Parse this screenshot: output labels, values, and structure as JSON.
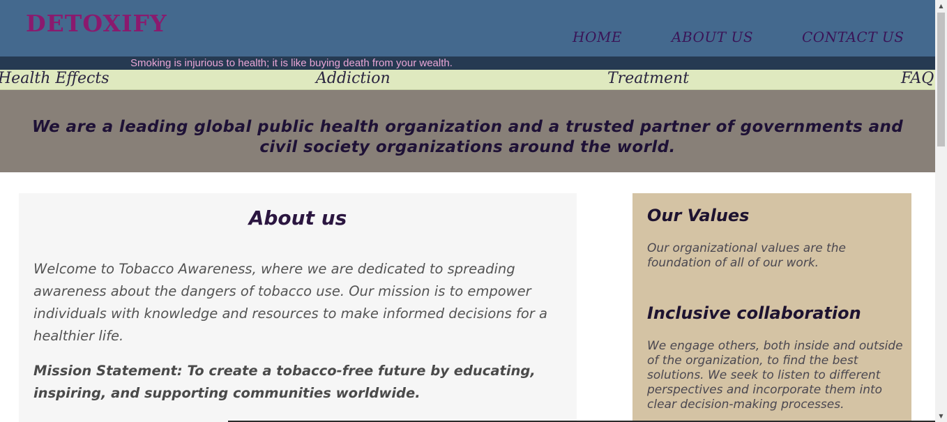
{
  "header": {
    "logo": "DETOXIFY",
    "nav": [
      "HOME",
      "ABOUT US",
      "CONTACT US"
    ]
  },
  "marquee": {
    "text": "Smoking is injurious to health; it is like buying death from your wealth."
  },
  "subnav": {
    "items": [
      "Health Effects",
      "Addiction",
      "Treatment",
      "FAQ"
    ]
  },
  "banner": {
    "text": "We are a leading global public health organization and a trusted partner of governments and civil society organizations around the world."
  },
  "about": {
    "title": "About us",
    "paragraph": "Welcome to Tobacco Awareness, where we are dedicated to spreading awareness about the dangers of tobacco use. Our mission is to empower individuals with knowledge and resources to make informed decisions for a healthier life.",
    "mission": "Mission Statement: To create a tobacco-free future by educating, inspiring, and supporting communities worldwide."
  },
  "values": {
    "heading": "Our Values",
    "intro": "Our organizational values are the foundation of all of our work.",
    "collab_heading": "Inclusive collaboration",
    "collab_text": "We engage others, both inside and outside of the organization, to find the best solutions. We seek to listen to different perspectives and incorporate them into clear decision-making processes."
  },
  "colors": {
    "header_bg": "#44698e",
    "logo": "#8a1a6e",
    "marquee_bg": "#263a52",
    "marquee_text": "#e9a6d6",
    "subnav_bg": "#dfe9bf",
    "banner_bg": "#888078",
    "values_bg": "#d4c3a4"
  },
  "icons": {
    "scroll_up": "scroll-up-arrow-icon",
    "scroll_down": "scroll-down-arrow-icon"
  }
}
